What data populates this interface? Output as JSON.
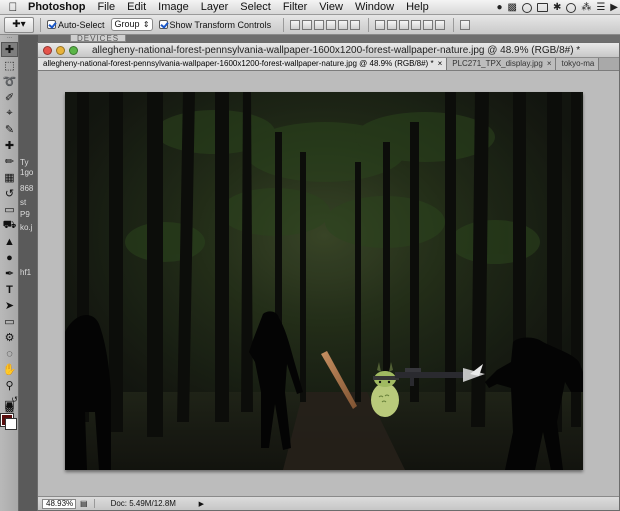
{
  "menubar": {
    "items": [
      "Photoshop",
      "File",
      "Edit",
      "Image",
      "Layer",
      "Select",
      "Filter",
      "View",
      "Window",
      "Help"
    ],
    "status_icons": [
      "apple-icon",
      "wifi-icon",
      "volume-icon",
      "battery-icon",
      "clock-icon"
    ]
  },
  "options": {
    "auto_select_label": "Auto-Select",
    "auto_select_value": "Group",
    "transform_label": "Show Transform Controls"
  },
  "background_panels": {
    "devices_tab": "DEVICES",
    "side_text": [
      "Ty",
      "1go",
      "868",
      "st",
      "P9",
      "ko.j",
      "hf1"
    ]
  },
  "document": {
    "title": "allegheny-national-forest-pennsylvania-wallpaper-1600x1200-forest-wallpaper-nature.jpg @ 48.9% (RGB/8#) *",
    "tabs": [
      {
        "label": "allegheny-national-forest-pennsylvania-wallpaper-1600x1200-forest-wallpaper-nature.jpg @ 48.9% (RGB/8#) *",
        "active": true
      },
      {
        "label": "PLC271_TPX_display.jpg",
        "active": false
      },
      {
        "label": "tokyo-ma",
        "active": false
      }
    ],
    "zoom": "48.93%",
    "doc_info": "Doc: 5.49M/12.8M"
  },
  "colors": {
    "foreground": "#5a0e0e",
    "background": "#ffffff"
  }
}
